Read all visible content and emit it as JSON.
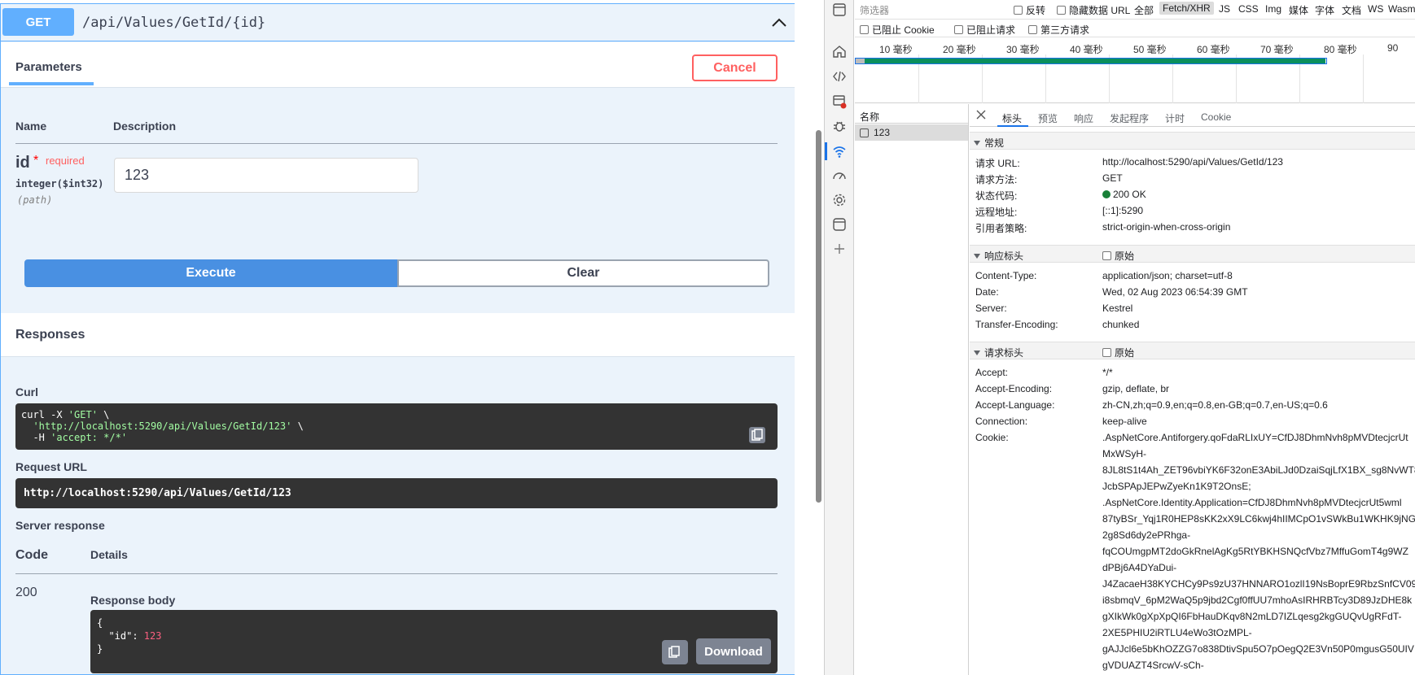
{
  "swagger": {
    "method": "GET",
    "path": "/api/Values/GetId/{id}",
    "params_tab": "Parameters",
    "cancel_label": "Cancel",
    "col_name": "Name",
    "col_description": "Description",
    "param": {
      "name": "id",
      "required_star": "*",
      "required_label": "required",
      "type": "integer($int32)",
      "in": "(path)",
      "value": "123"
    },
    "execute_label": "Execute",
    "clear_label": "Clear",
    "responses_title": "Responses",
    "curl_label": "Curl",
    "curl": {
      "line1_cmd": "curl -X ",
      "line1_method": "'GET'",
      "line1_tail": " \\",
      "line2_url": "'http://localhost:5290/api/Values/GetId/123'",
      "line2_tail": " \\",
      "line3_flag": "  -H ",
      "line3_header": "'accept: */*'"
    },
    "request_url_label": "Request URL",
    "request_url": "http://localhost:5290/api/Values/GetId/123",
    "server_response_label": "Server response",
    "code_label": "Code",
    "details_label": "Details",
    "code_value": "200",
    "response_body_label": "Response body",
    "response_body": {
      "open": "{",
      "key": "  \"id\": ",
      "value": "123",
      "close": "}"
    },
    "download_label": "Download"
  },
  "devtools": {
    "filter_placeholder": "筛选器",
    "invert_label": "反转",
    "hide_data_urls_label": "隐藏数据 URL",
    "all_label": "全部",
    "types": [
      "Fetch/XHR",
      "JS",
      "CSS",
      "Img",
      "媒体",
      "字体",
      "文档",
      "WS",
      "Wasm"
    ],
    "active_type": "Fetch/XHR",
    "block_cookies_label": "已阻止 Cookie",
    "blocked_requests_label": "已阻止请求",
    "third_party_label": "第三方请求",
    "timeline_ticks": [
      "10 毫秒",
      "20 毫秒",
      "30 毫秒",
      "40 毫秒",
      "50 毫秒",
      "60 毫秒",
      "70 毫秒",
      "80 毫秒",
      "90"
    ],
    "name_col": "名称",
    "request_name": "123",
    "tabs": [
      "标头",
      "预览",
      "响应",
      "发起程序",
      "计时",
      "Cookie"
    ],
    "general_title": "常规",
    "general": [
      {
        "k": "请求 URL:",
        "v": "http://localhost:5290/api/Values/GetId/123"
      },
      {
        "k": "请求方法:",
        "v": "GET"
      },
      {
        "k": "状态代码:",
        "v": "200 OK"
      },
      {
        "k": "远程地址:",
        "v": "[::1]:5290"
      },
      {
        "k": "引用者策略:",
        "v": "strict-origin-when-cross-origin"
      }
    ],
    "raw_label": "原始",
    "response_headers_title": "响应标头",
    "response_headers": [
      {
        "k": "Content-Type:",
        "v": "application/json; charset=utf-8"
      },
      {
        "k": "Date:",
        "v": "Wed, 02 Aug 2023 06:54:39 GMT"
      },
      {
        "k": "Server:",
        "v": "Kestrel"
      },
      {
        "k": "Transfer-Encoding:",
        "v": "chunked"
      }
    ],
    "request_headers_title": "请求标头",
    "request_headers": [
      {
        "k": "Accept:",
        "v": "*/*"
      },
      {
        "k": "Accept-Encoding:",
        "v": "gzip, deflate, br"
      },
      {
        "k": "Accept-Language:",
        "v": "zh-CN,zh;q=0.9,en;q=0.8,en-GB;q=0.7,en-US;q=0.6"
      },
      {
        "k": "Connection:",
        "v": "keep-alive"
      },
      {
        "k": "Cookie:",
        "v": ".AspNetCore.Antiforgery.qoFdaRLIxUY=CfDJ8DhmNvh8pMVDtecjcrUt"
      }
    ],
    "cookie_lines": [
      "MxWSyH-",
      "8JL8tS1t4Ah_ZET96vbiYK6F32onE3AbiLJd0DzaiSqjLfX1BX_sg8NvWT8",
      "JcbSPApJEPwZyeKn1K9T2OnsE;",
      ".AspNetCore.Identity.Application=CfDJ8DhmNvh8pMVDtecjcrUt5wml",
      "87tyBSr_Yqj1R0HEP8sKK2xX9LC6kwj4hIIMCpO1vSWkBu1WKHK9jNG8",
      "2g8Sd6dy2ePRhga-",
      "fqCOUmgpMT2doGkRnelAgKg5RtYBKHSNQcfVbz7MffuGomT4g9WZ",
      "dPBj6A4DYaDui-",
      "J4ZacaeH38KYCHCy9Ps9zU37HNNARO1ozlI19NsBoprE9RbzSnfCV09x",
      "i8sbmqV_6pM2WaQ5p9jbd2Cgf0ffUU7mhoAsIRHRBTcy3D89JzDHE8k",
      "gXIkWk0gXpXpQI6FbHauDKqv8N2mLD7IZLqesg2kgGUQvUgRFdT-",
      "2XE5PHIU2iRTLU4eWo3tOzMPL-",
      "gAJJcl6e5bKhOZZG7o838DtivSpu5O7pOegQ2E3Vn50P0mgusG50UIV",
      "gVDUAZT4SrcwV-sCh-"
    ]
  }
}
